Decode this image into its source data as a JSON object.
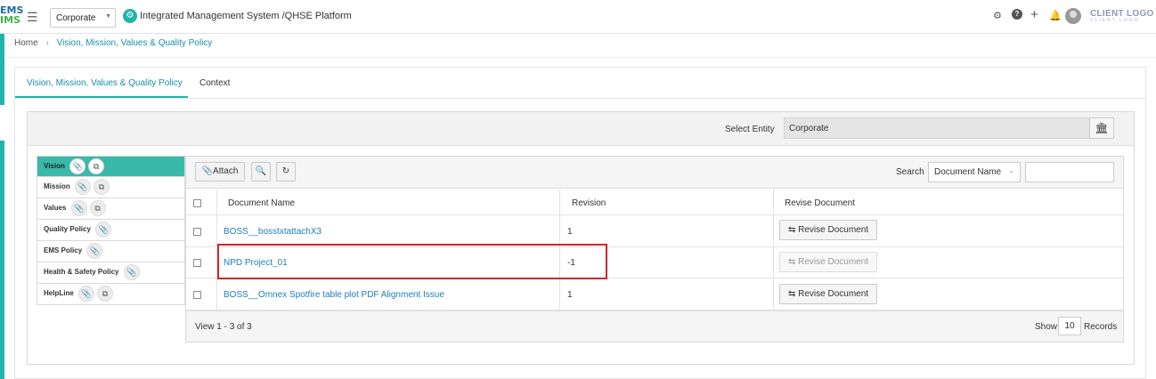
{
  "header": {
    "logo_line1": "EMS",
    "logo_line2": "IMS",
    "entity_select": "Corporate",
    "app_title": "Integrated Management System /QHSE Platform",
    "client_logo": "CLIENT LOGO",
    "client_logo_sub": "CLIENT LOGO",
    "icons": [
      "gear-icon",
      "help-icon",
      "plus-icon",
      "bell-icon",
      "avatar"
    ]
  },
  "breadcrumb": {
    "home": "Home",
    "current": "Vision, Mission, Values & Quality Policy"
  },
  "tabs": [
    {
      "label": "Vision, Mission, Values & Quality Policy",
      "active": true
    },
    {
      "label": "Context",
      "active": false
    }
  ],
  "entity": {
    "label": "Select Entity",
    "value": "Corporate"
  },
  "left_list": [
    {
      "label": "Vision",
      "icons": [
        "attach",
        "copy"
      ],
      "active": true
    },
    {
      "label": "Mission",
      "icons": [
        "attach",
        "copy"
      ]
    },
    {
      "label": "Values",
      "icons": [
        "attach",
        "copy"
      ]
    },
    {
      "label": "Quality Policy",
      "icons": [
        "attach"
      ]
    },
    {
      "label": "EMS Policy",
      "icons": [
        "attach"
      ]
    },
    {
      "label": "Health & Safety Policy",
      "icons": [
        "attach"
      ]
    },
    {
      "label": "HelpLine",
      "icons": [
        "attach",
        "copy"
      ]
    }
  ],
  "toolbar": {
    "attach_label": "Attach",
    "search_label": "Search",
    "search_field": "Document Name",
    "search_value": ""
  },
  "table": {
    "columns": [
      "Document Name",
      "Revision",
      "Revise Document"
    ],
    "rows": [
      {
        "name": "BOSS__bosstxtattachX3",
        "revision": "1",
        "action": "Revise Document",
        "enabled": true
      },
      {
        "name": "NPD Project_01",
        "revision": "-1",
        "action": "Revise Document",
        "enabled": false,
        "highlighted": true
      },
      {
        "name": "BOSS__Omnex Spotfire table plot PDF Alignment Issue",
        "revision": "1",
        "action": "Revise Document",
        "enabled": true
      }
    ]
  },
  "footer": {
    "view_text": "View 1 - 3 of 3",
    "show_label": "Show",
    "page_size": "10",
    "records_label": "Records"
  },
  "colors": {
    "accent": "#1fb5ad",
    "active_row": "#39b9aa",
    "link": "#1b7fbd",
    "highlight": "#d2262c"
  }
}
